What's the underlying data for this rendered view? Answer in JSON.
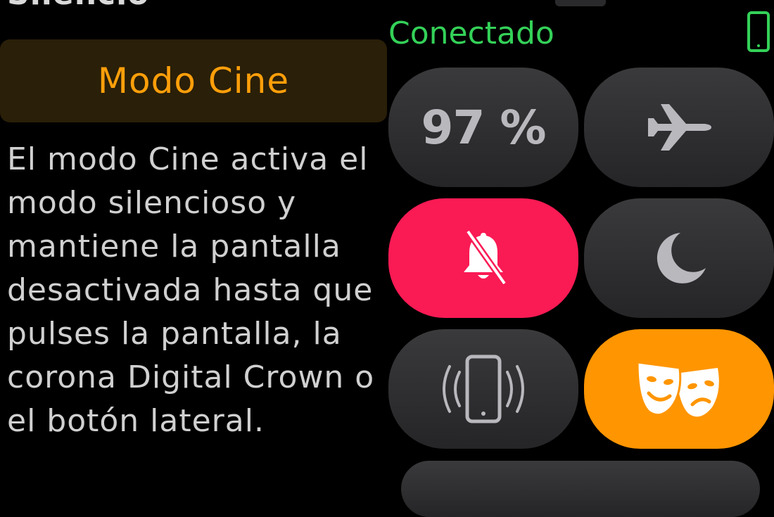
{
  "page": {
    "top_title": "Silencio",
    "mode_title": "Modo Cine",
    "description": "El modo Cine activa el modo silencioso y mantiene la pantalla desactivada hasta que pulses la pantalla, la corona Digital Crown o el botón lateral."
  },
  "status": {
    "connection": "Conectado",
    "connection_color": "#34d158",
    "device_icon": "iphone-icon"
  },
  "controls": {
    "battery_label": "97 %",
    "airplane_icon": "airplane-icon",
    "silent_icon": "bell-slash-icon",
    "dnd_icon": "moon-icon",
    "ping_icon": "iphone-ping-icon",
    "theater_icon": "theater-masks-icon",
    "silent_color": "#fa1a54",
    "theater_color": "#ff9500"
  }
}
